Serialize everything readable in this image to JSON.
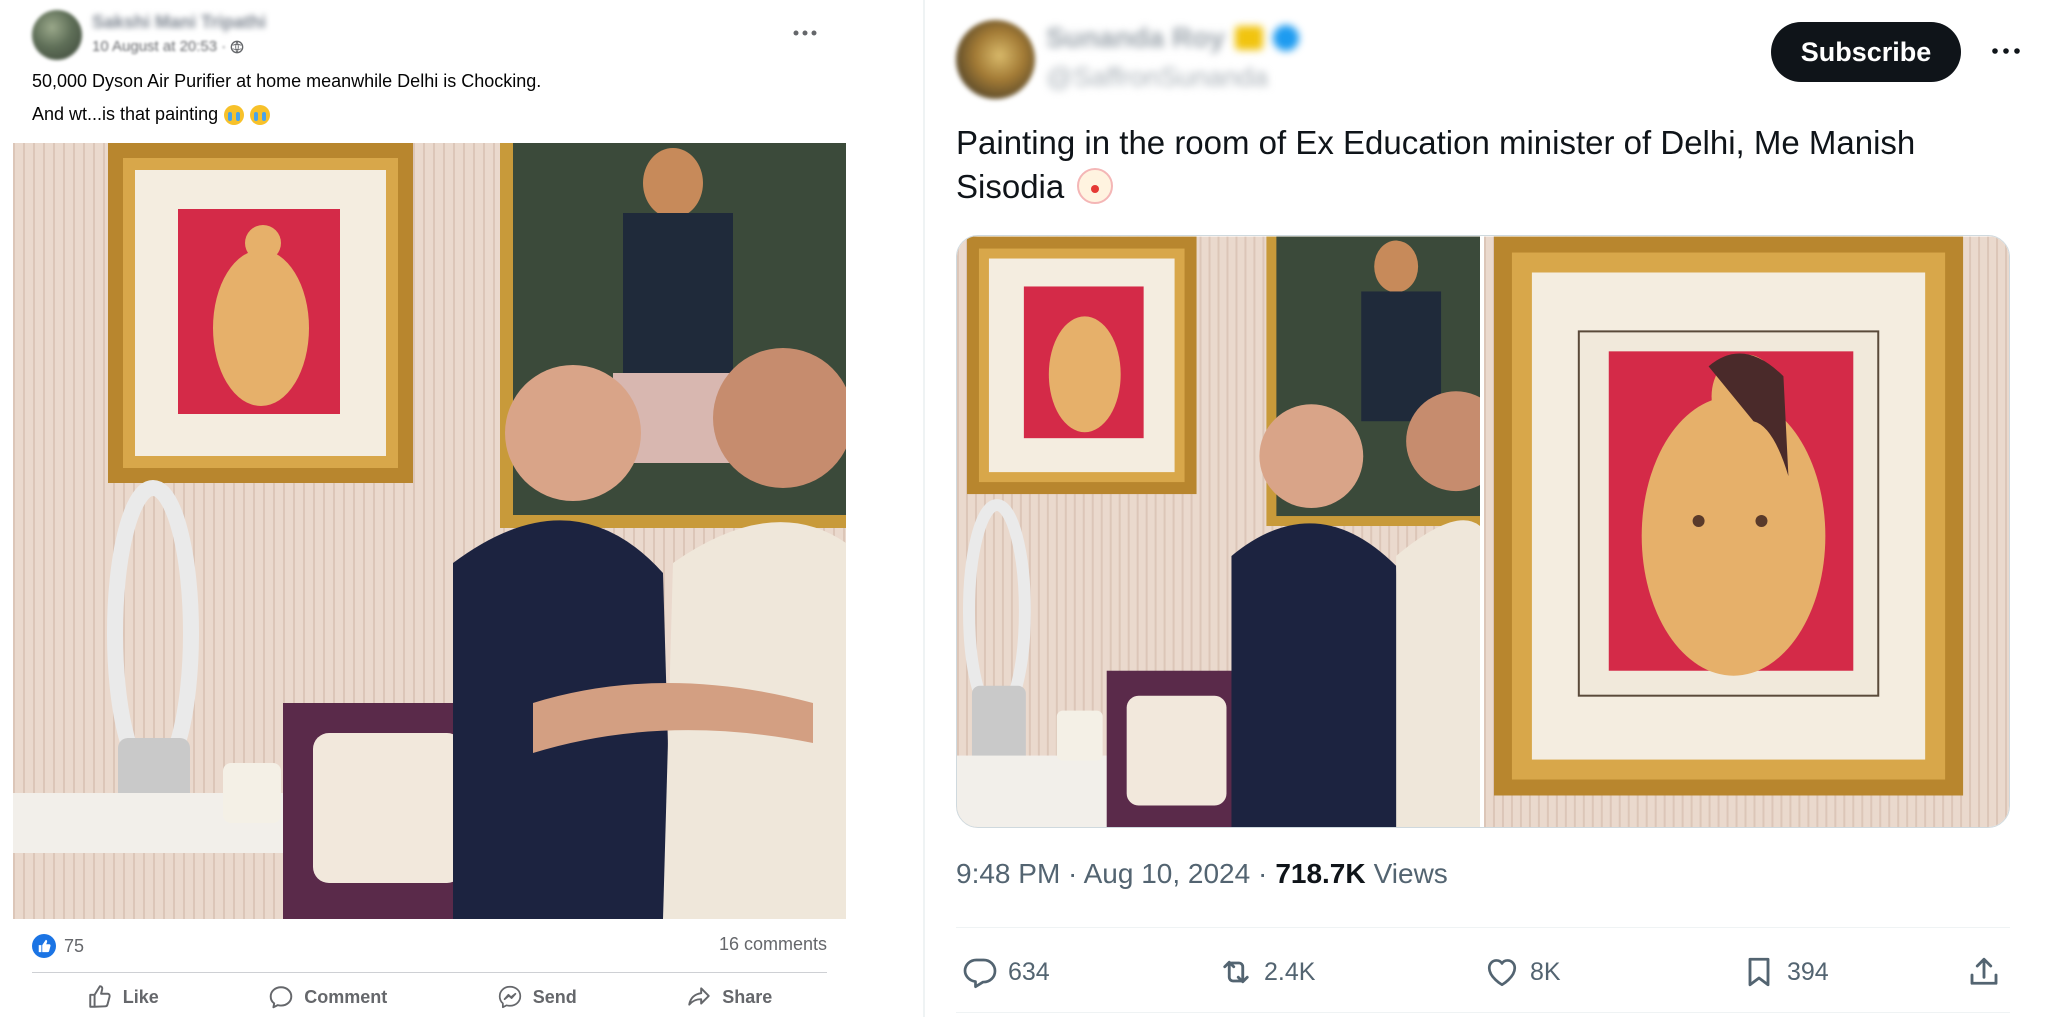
{
  "facebook_post": {
    "author_name": "Sakshi Mani Tripathi",
    "timestamp": "10 August at 20:53 ·",
    "privacy_icon": "globe-icon",
    "text_line1": "50,000 Dyson Air Purifier at home meanwhile Delhi is Chocking.",
    "text_line2": "And wt...is that painting",
    "reaction_count": "75",
    "comments": "16 comments",
    "actions": {
      "like": "Like",
      "comment": "Comment",
      "send": "Send",
      "share": "Share"
    },
    "colors": {
      "like_blue": "#1b74e4",
      "secondary_text": "#65676b"
    }
  },
  "x_post": {
    "display_name": "Sunanda Roy",
    "handle": "@SaffronSunanda",
    "subscribe_label": "Subscribe",
    "text": "Painting in the room of Ex Education minister of Delhi, Me Manish Sisodia",
    "posted_time": "9:48 PM · Aug 10, 2024 ·",
    "views_count": "718.7K",
    "views_label": "Views",
    "stats": {
      "replies": "634",
      "reposts": "2.4K",
      "likes": "8K",
      "bookmarks": "394"
    },
    "colors": {
      "button_bg": "#0f1419",
      "secondary_text": "#536471",
      "verified_blue": "#1d9bf0"
    }
  }
}
